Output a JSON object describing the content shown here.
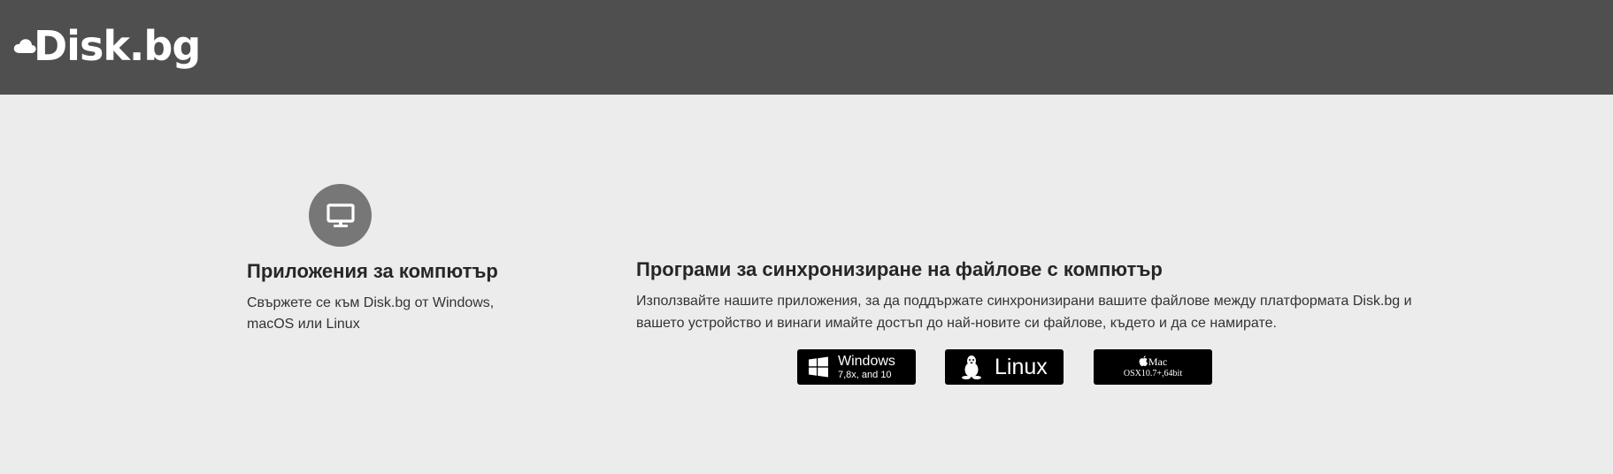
{
  "header": {
    "logo_text": "Disk.bg",
    "background": "#4f4f4f"
  },
  "app_section": {
    "icon": "monitor-icon",
    "title": "Приложения за компютър",
    "description": "Свържете се към Disk.bg от Windows, macOS или Linux"
  },
  "sync_section": {
    "title": "Програми за синхронизиране на файлове с компютър",
    "description": "Използвайте нашите приложения, за да поддържате синхронизирани вашите файлове между платформата Disk.bg и вашето устройство и винаги имайте достъп до най-новите си файлове, където и да се намирате."
  },
  "downloads": {
    "windows": {
      "label": "Windows",
      "sub": "7,8x, and 10",
      "icon": "windows-icon"
    },
    "linux": {
      "label": "Linux",
      "icon": "linux-penguin-icon"
    },
    "mac": {
      "label": "Mac",
      "sub": "OSX10.7+,64bit",
      "icon": "apple-icon"
    }
  },
  "colors": {
    "page_bg": "#ececec",
    "button_bg": "#000000",
    "icon_circle": "#777777"
  }
}
